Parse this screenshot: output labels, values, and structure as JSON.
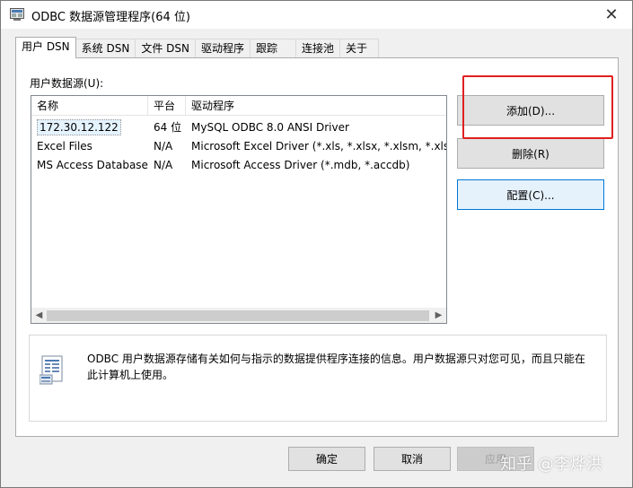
{
  "window": {
    "title": "ODBC 数据源管理程序(64 位)",
    "close_glyph": "✕"
  },
  "tabs": [
    {
      "label": "用户 DSN",
      "active": true
    },
    {
      "label": "系统 DSN",
      "active": false
    },
    {
      "label": "文件 DSN",
      "active": false
    },
    {
      "label": "驱动程序",
      "active": false
    },
    {
      "label": "跟踪",
      "active": false
    },
    {
      "label": "连接池",
      "active": false
    },
    {
      "label": "关于",
      "active": false
    }
  ],
  "user_dsn": {
    "list_label": "用户数据源(U):",
    "columns": [
      "名称",
      "平台",
      "驱动程序"
    ],
    "rows": [
      {
        "name": "172.30.12.122",
        "platform": "64 位",
        "driver": "MySQL ODBC 8.0 ANSI Driver"
      },
      {
        "name": "Excel Files",
        "platform": "N/A",
        "driver": "Microsoft Excel Driver (*.xls, *.xlsx, *.xlsm, *.xlsb)"
      },
      {
        "name": "MS Access Database",
        "platform": "N/A",
        "driver": "Microsoft Access Driver (*.mdb, *.accdb)"
      }
    ],
    "buttons": {
      "add": "添加(D)...",
      "remove": "删除(R)",
      "configure": "配置(C)..."
    },
    "info_text": "ODBC 用户数据源存储有关如何与指示的数据提供程序连接的信息。用户数据源只对您可见，而且只能在此计算机上使用。"
  },
  "footer": {
    "ok": "确定",
    "cancel": "取消",
    "apply": "应用"
  },
  "watermark": "知乎 @李烨洪",
  "colors": {
    "highlight_box": "#e02020",
    "focus_border": "#0078d7"
  }
}
